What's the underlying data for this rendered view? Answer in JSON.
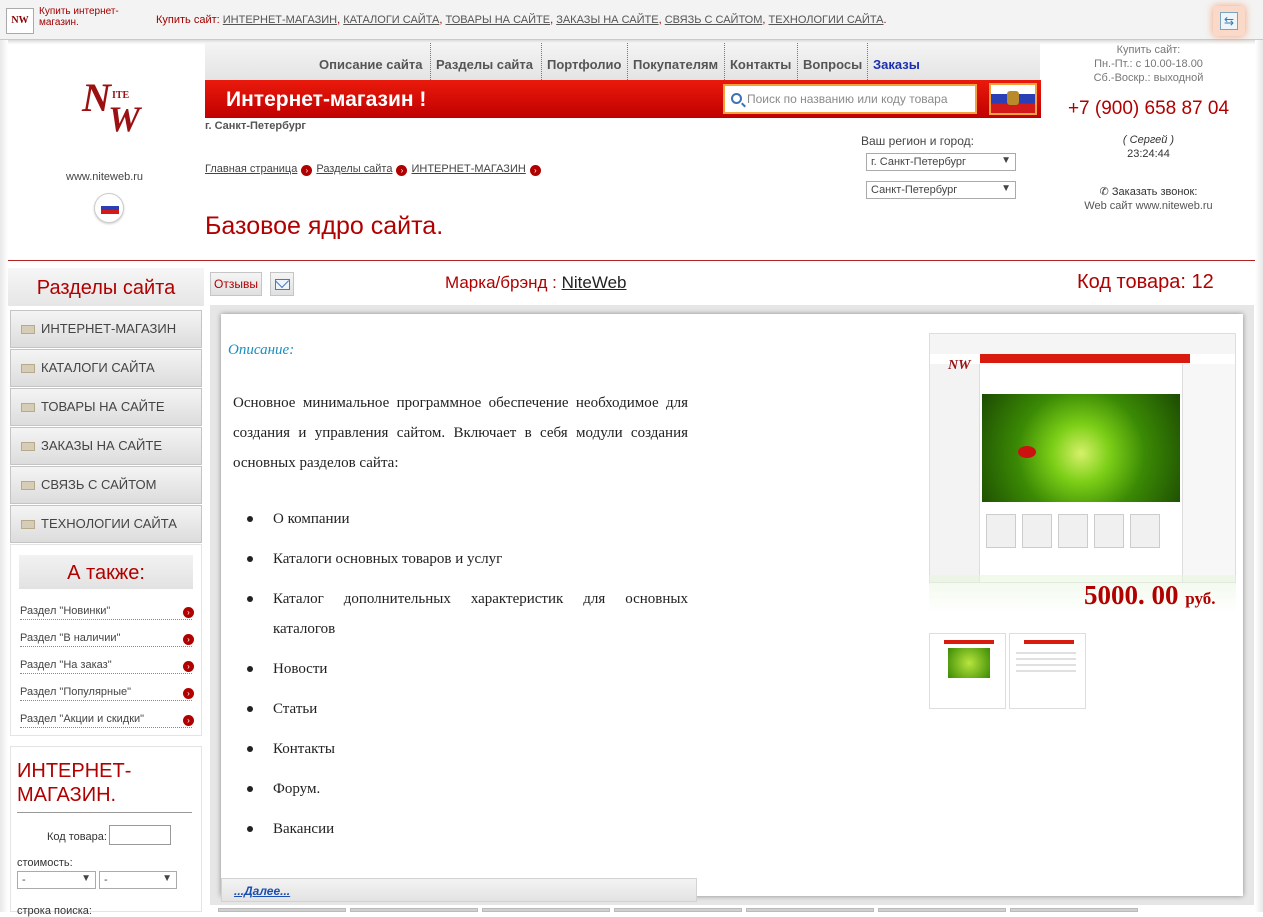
{
  "topbar": {
    "mini_logo": "NW",
    "mini_title": "Купить интернет-магазин.",
    "buy_label": "Купить сайт:",
    "links": [
      "ИНТЕРНЕТ-МАГАЗИН",
      "КАТАЛОГИ САЙТА",
      "ТОВАРЫ НА САЙТЕ",
      "ЗАКАЗЫ НА САЙТЕ",
      "СВЯЗЬ С САЙТОМ",
      "ТЕХНОЛОГИИ САЙТА"
    ],
    "sep": ",",
    "end": ".",
    "swap_icon": "swap-arrows-icon"
  },
  "header": {
    "site_url": "www.niteweb.ru",
    "nav": [
      "Описание сайта",
      "Разделы сайта",
      "Портфолио",
      "Покупателям",
      "Контакты",
      "Вопросы",
      "Заказы"
    ],
    "banner_title": "Интернет-магазин !",
    "search_placeholder": "Поиск по названию или коду товара",
    "city_under": "г. Санкт-Петербург",
    "breadcrumb": [
      "Главная страница",
      "Разделы сайта",
      "ИНТЕРНЕТ-МАГАЗИН"
    ],
    "page_title": "Базовое ядро сайта.",
    "region_label": "Ваш регион и город:",
    "region_select": "г. Санкт-Петербург",
    "city_select": "Санкт-Петербург"
  },
  "contact": {
    "buy_lines": [
      "Купить сайт:",
      "Пн.-Пт.: с 10.00-18.00",
      "Сб.-Воскр.: выходной"
    ],
    "phone": "+7 (900) 658 87 04",
    "person": "( Сергей )",
    "time": "23:24:44",
    "callback": "Заказать звонок:",
    "web_label": "Web сайт",
    "web_url": "www.niteweb.ru"
  },
  "sidebar": {
    "title": "Разделы сайта",
    "items": [
      "ИНТЕРНЕТ-МАГАЗИН",
      "КАТАЛОГИ САЙТА",
      "ТОВАРЫ НА САЙТЕ",
      "ЗАКАЗЫ НА САЙТЕ",
      "СВЯЗЬ С САЙТОМ",
      "ТЕХНОЛОГИИ САЙТА"
    ],
    "also_title": "А также:",
    "also_links": [
      "Раздел \"Новинки\"",
      "Раздел \"В наличии\"",
      "Раздел \"На заказ\"",
      "Раздел \"Популярные\"",
      "Раздел \"Акции и скидки\""
    ],
    "filter": {
      "title": "ИНТЕРНЕТ-МАГАЗИН.",
      "code_label": "Код товара:",
      "code_value": "",
      "price_label": "стоимость:",
      "price_from": "-",
      "price_to": "-",
      "search_label": "строка поиска:"
    }
  },
  "product": {
    "reviews_button": "Отзывы",
    "mail_icon": "envelope-icon",
    "brand_label": "Марка/брэнд :",
    "brand": "NiteWeb",
    "code_label": "Код товара:",
    "code": "12",
    "desc_label": "Описание:",
    "desc_text": "Основное минимальное программное обеспечение необходимое для создания и управления сайтом. Включает в себя модули создания основных разделов сайта:",
    "features": [
      "О компании",
      "Каталоги основных товаров и услуг",
      "Каталог дополнительных характеристик для основных каталогов",
      "Новости",
      "Статьи",
      "Контакты",
      "Форум.",
      "Вакансии"
    ],
    "more_link": "...Далее...",
    "price": "5000. 00",
    "currency": "руб."
  },
  "colors": {
    "accent_red": "#b00000",
    "banner_red": "#d81b0e",
    "link_blue": "#1a2fb0"
  }
}
